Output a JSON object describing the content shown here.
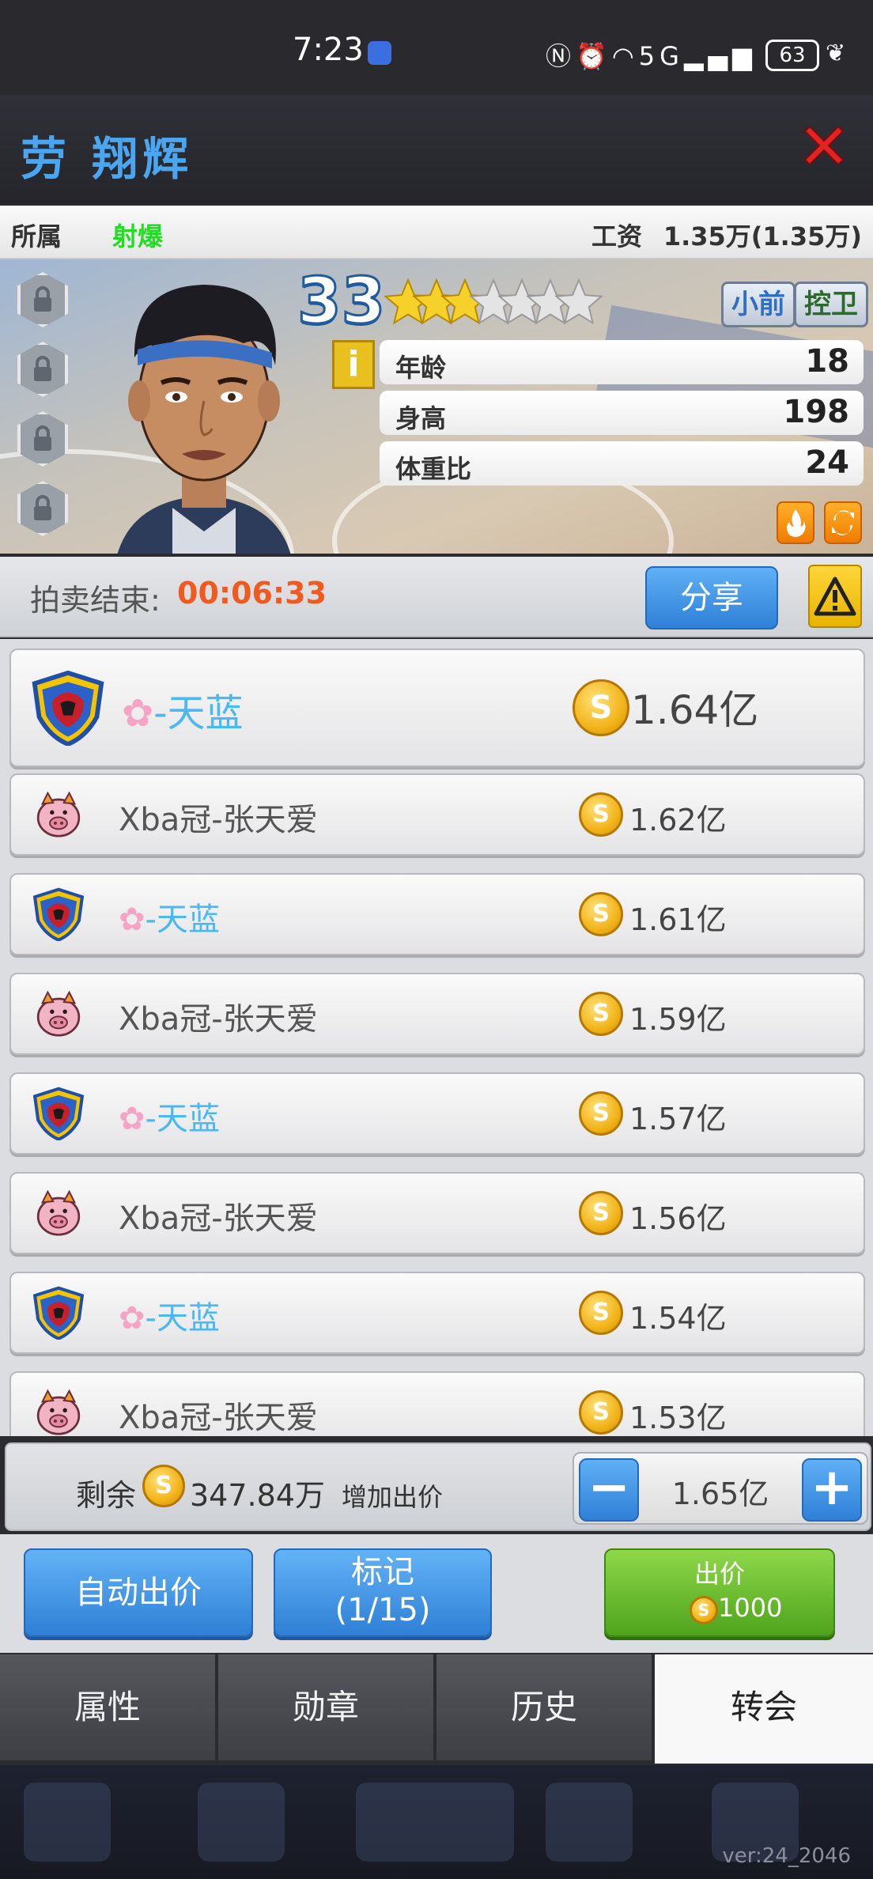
{
  "status_bar": {
    "time": "7:23",
    "battery": "63",
    "signal": "5G"
  },
  "header": {
    "player_name": "劳 翔辉"
  },
  "info": {
    "affiliation_label": "所属",
    "affiliation_value": "射爆",
    "salary_label": "工资",
    "salary_value": "1.35万(1.35万)"
  },
  "player": {
    "overall": "33",
    "stars_filled": 3,
    "stars_total": 7,
    "positions": [
      "小前",
      "控卫"
    ],
    "stats": [
      {
        "label": "年龄",
        "value": "18"
      },
      {
        "label": "身高",
        "value": "198"
      },
      {
        "label": "体重比",
        "value": "24"
      }
    ]
  },
  "auction": {
    "label": "拍卖结束:",
    "time": "00:06:33",
    "share_label": "分享"
  },
  "bids": [
    {
      "name": "-天蓝",
      "amount": "1.64亿",
      "flower": true,
      "team": "sky",
      "top": true
    },
    {
      "name": "Xba冠-张天爱",
      "amount": "1.62亿",
      "flower": false,
      "team": "pig"
    },
    {
      "name": "-天蓝",
      "amount": "1.61亿",
      "flower": true,
      "team": "sky"
    },
    {
      "name": "Xba冠-张天爱",
      "amount": "1.59亿",
      "flower": false,
      "team": "pig"
    },
    {
      "name": "-天蓝",
      "amount": "1.57亿",
      "flower": true,
      "team": "sky"
    },
    {
      "name": "Xba冠-张天爱",
      "amount": "1.56亿",
      "flower": false,
      "team": "pig"
    },
    {
      "name": "-天蓝",
      "amount": "1.54亿",
      "flower": true,
      "team": "sky"
    },
    {
      "name": "Xba冠-张天爱",
      "amount": "1.53亿",
      "flower": false,
      "team": "pig"
    }
  ],
  "remain": {
    "label": "剩余",
    "amount": "347.84万",
    "increase_label": "增加出价",
    "bid_value": "1.65亿"
  },
  "actions": {
    "auto_bid": "自动出价",
    "mark_line1": "标记",
    "mark_line2": "(1/15)",
    "bid_label": "出价",
    "bid_cost": "1000"
  },
  "tabs": [
    "属性",
    "勋章",
    "历史",
    "转会"
  ],
  "active_tab": 3,
  "version": "ver:24_2046",
  "colors": {
    "accent_blue": "#4aa6f0",
    "affiliation_green": "#22dd22",
    "timer_orange": "#f05a1e",
    "sky_name": "#4cb8f0"
  }
}
